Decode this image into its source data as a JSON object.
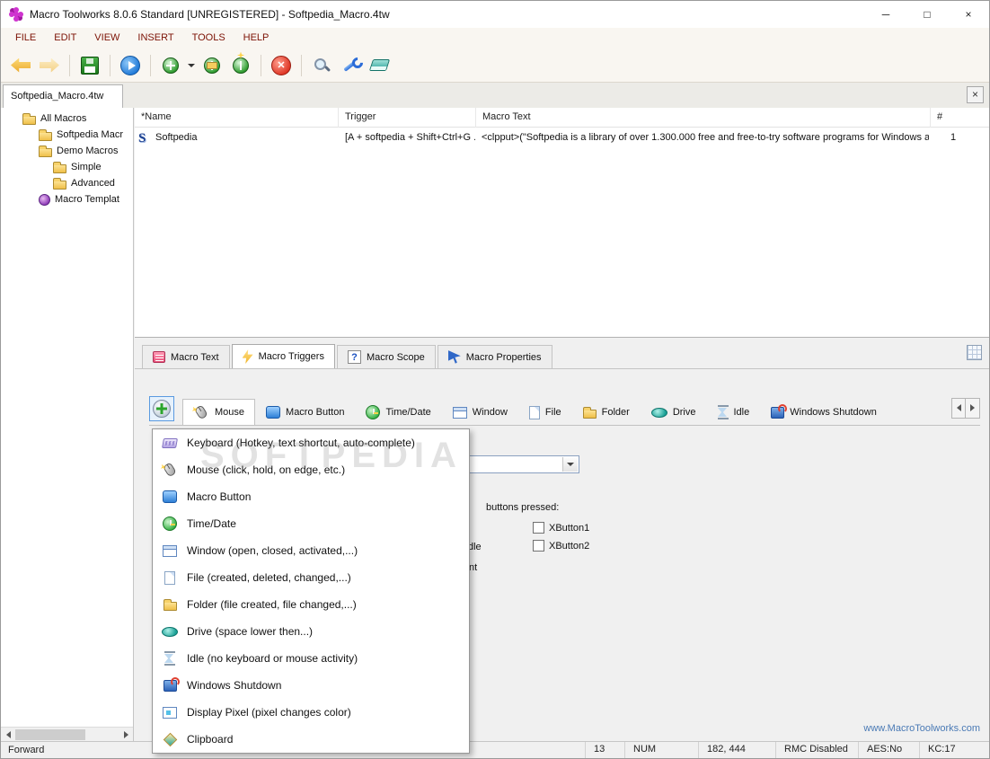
{
  "window": {
    "title": "Macro Toolworks 8.0.6 Standard [UNREGISTERED] - Softpedia_Macro.4tw",
    "minimize": "─",
    "maximize": "□",
    "close": "×"
  },
  "menubar": {
    "items": [
      "FILE",
      "EDIT",
      "VIEW",
      "INSERT",
      "TOOLS",
      "HELP"
    ]
  },
  "toolbar": {
    "icons": [
      "back-arrow",
      "forward-arrow",
      "save",
      "run-macro",
      "new-macro",
      "new-macro-dropdown",
      "new-macro-in-group",
      "new-group",
      "stop",
      "find",
      "tools",
      "clear"
    ]
  },
  "tab_strip": {
    "file_tab": "Softpedia_Macro.4tw",
    "close": "×"
  },
  "tree": {
    "items": [
      "All Macros",
      "Softpedia Macr",
      "Demo Macros",
      "Simple",
      "Advanced",
      "Macro Templat"
    ]
  },
  "macro_list": {
    "columns": {
      "name": "*Name",
      "trigger": "Trigger",
      "text": "Macro Text",
      "num": "#"
    },
    "row": {
      "name": "Softpedia",
      "trigger": "[A + softpedia + Shift+Ctrl+G ...",
      "text": "<clpput>(\"Softpedia is a library of over 1.300.000 free and free-to-try software programs for Windows a...",
      "num": "1"
    }
  },
  "detail_tabs": {
    "macro_text": "Macro Text",
    "macro_triggers": "Macro Triggers",
    "macro_scope": "Macro Scope",
    "macro_properties": "Macro Properties"
  },
  "trigger_bar": {
    "tabs": [
      "Mouse",
      "Macro Button",
      "Time/Date",
      "Window",
      "File",
      "Folder",
      "Drive",
      "Idle",
      "Windows Shutdown"
    ]
  },
  "trigger_menu": {
    "items": [
      "Keyboard (Hotkey, text shortcut, auto-complete)",
      "Mouse (click, hold, on edge, etc.)",
      "Macro Button",
      "Time/Date",
      "Window (open, closed, activated,...)",
      "File (created, deleted, changed,...)",
      "Folder (file created, file changed,...)",
      "Drive (space lower then...)",
      "Idle (no keyboard or mouse activity)",
      "Windows Shutdown",
      "Display Pixel (pixel changes color)",
      "Clipboard"
    ]
  },
  "trigger_panel": {
    "buttons_pressed": "buttons pressed:",
    "xbutton1": "XButton1",
    "xbutton2": "XButton2",
    "fragment1": "dle",
    "fragment2": "nt"
  },
  "footer": {
    "link": "www.MacroToolworks.com"
  },
  "statusbar": {
    "mode": "Forward",
    "count": "13",
    "numlock": "NUM",
    "coords": "182, 444",
    "rmc": "RMC Disabled",
    "aes": "AES:No",
    "kc": "KC:17"
  },
  "watermark": "SOFTPEDIA"
}
